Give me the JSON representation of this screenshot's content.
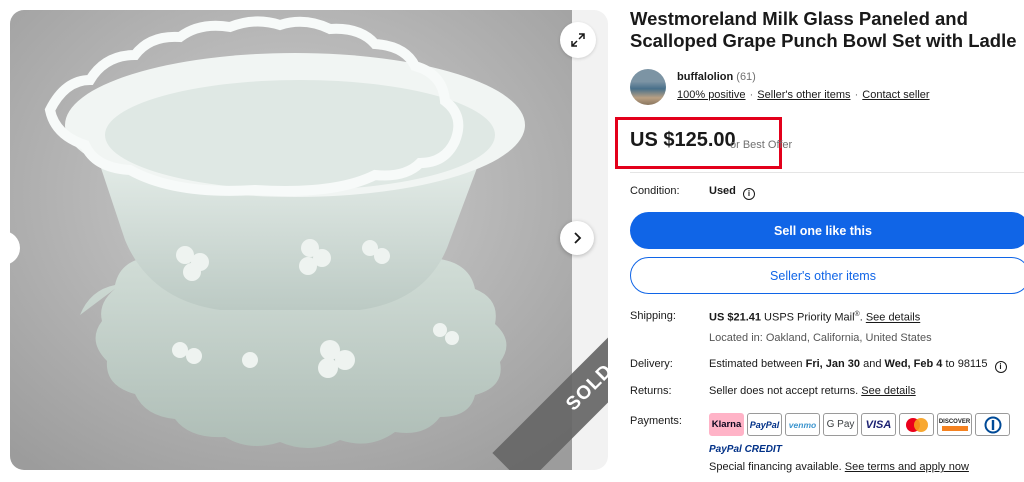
{
  "listing": {
    "title": "Westmoreland Milk Glass Paneled and Scalloped Grape Punch Bowl Set with Ladle",
    "image_alt": "Milk glass punch bowl with matching scalloped underplate",
    "sold_label": "SOLD"
  },
  "gallery": {
    "expand_icon": "expand-icon",
    "next_icon": "chevron-right-icon",
    "prev_icon": "chevron-left-icon"
  },
  "seller": {
    "name": "buffalolion",
    "feedback_count": "(61)",
    "positive": "100% positive",
    "other_items_link": "Seller's other items",
    "contact_link": "Contact seller"
  },
  "price": {
    "amount": "US $125.00",
    "best_offer": "or Best Offer",
    "highlight_color": "#e3001b"
  },
  "condition": {
    "label": "Condition:",
    "value": "Used"
  },
  "buttons": {
    "sell_one": "Sell one like this",
    "other_items": "Seller's other items",
    "primary_color": "#1065e7"
  },
  "shipping": {
    "label": "Shipping:",
    "cost": "US $21.41",
    "service": "USPS Priority Mail",
    "service_mark": "®",
    "details_link": "See details",
    "location": "Located in: Oakland, California, United States"
  },
  "delivery": {
    "label": "Delivery:",
    "prefix": "Estimated between",
    "start": "Fri, Jan 30",
    "and": "and",
    "end": "Wed, Feb 4",
    "to": "to 98115"
  },
  "returns": {
    "label": "Returns:",
    "text": "Seller does not accept returns.",
    "details_link": "See details"
  },
  "payments": {
    "label": "Payments:",
    "methods": [
      "Klarna",
      "PayPal",
      "venmo",
      "G Pay",
      "VISA",
      "Mastercard",
      "DISCOVER",
      "Diners Club"
    ],
    "paypal_credit": "PayPal CREDIT",
    "financing_text": "Special financing available.",
    "financing_link": "See terms and apply now"
  }
}
